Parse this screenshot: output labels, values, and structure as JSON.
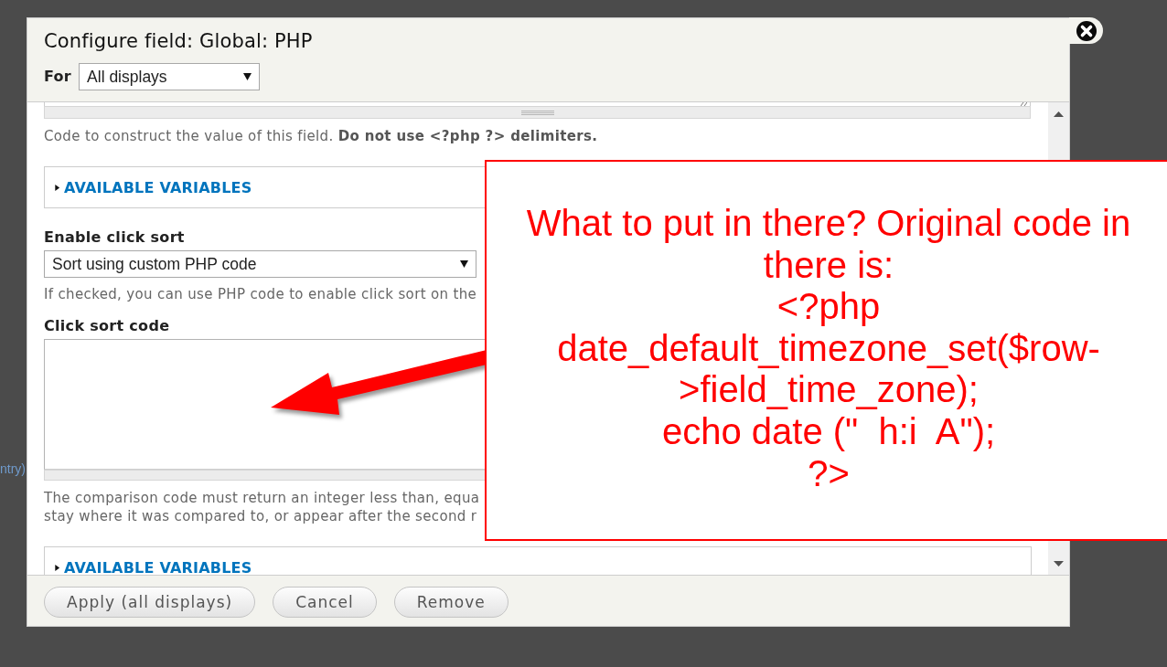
{
  "dialog": {
    "title": "Configure field: Global: PHP",
    "display": {
      "label": "For",
      "value": "All displays"
    }
  },
  "form": {
    "code_help": "Code to construct the value of this field. **Do not use <?php ?> delimiters.**",
    "code_variables": {
      "summary": "AVAILABLE VARIABLES",
      "expanded": false
    },
    "click_sort": {
      "label": "Enable click sort",
      "value": "Sort using custom PHP code",
      "help": "If checked, you can use PHP code to enable click sort on the"
    },
    "click_sort_code": {
      "label": "Click sort code",
      "help": [
        "The comparison code must return an integer less than, equa",
        "stay where it was compared to, or appear after the second r"
      ],
      "variables": {
        "summary": "AVAILABLE VARIABLES",
        "expanded": false
      }
    }
  },
  "buttons": [
    {
      "label": "Apply (all displays)"
    },
    {
      "label": "Cancel"
    },
    {
      "label": "Remove"
    }
  ],
  "annotation": {
    "lines": [
      "What to put in there? Original code in",
      "there is:",
      "<?php",
      "date_default_timezone_set($row-",
      ">field_time_zone);",
      "echo date (\"  h:i  A\");",
      "?>"
    ]
  },
  "background": {
    "text": "ntry)"
  }
}
